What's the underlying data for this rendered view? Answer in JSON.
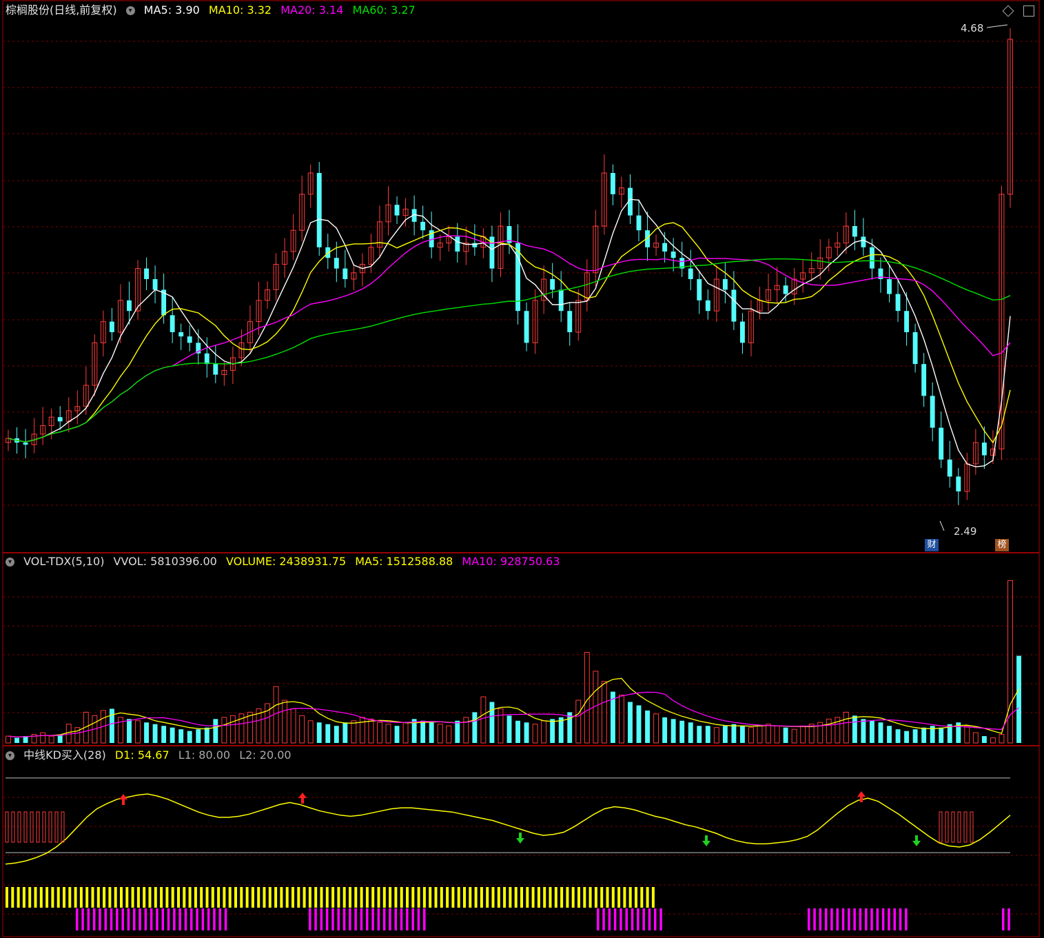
{
  "main_header": {
    "stock_name": "棕榈股份(日线,前复权)",
    "ma5_label": "MA5: 3.90",
    "ma10_label": "MA10: 3.32",
    "ma20_label": "MA20: 3.14",
    "ma60_label": "MA60: 3.27"
  },
  "volume_header": {
    "indicator_name": "VOL-TDX(5,10)",
    "vvol_label": "VVOL: 5810396.00",
    "volume_label": "VOLUME: 2438931.75",
    "ma5_label": "MA5: 1512588.88",
    "ma10_label": "MA10: 928750.63"
  },
  "kd_header": {
    "indicator_name": "中线KD买入(28)",
    "d1_label": "D1: 54.67",
    "l1_label": "L1: 80.00",
    "l2_label": "L2: 20.00"
  },
  "annotations": {
    "high_price": "4.68",
    "low_price": "2.49",
    "badge_finance": "财",
    "badge_rank": "榜"
  },
  "colors": {
    "up": "#ff3b3b",
    "down": "#54fcfc",
    "ma5": "#ffffff",
    "ma10": "#ffff00",
    "ma20": "#ff00ff",
    "ma60": "#00e000",
    "grid": "#7a0000",
    "kd_line": "#ffff00",
    "bar_yellow": "#ffff00",
    "bar_magenta": "#ff00ff"
  },
  "chart_data": [
    {
      "type": "candlestick",
      "title": "棕榈股份(日线,前复权)",
      "ylim": [
        2.3,
        4.8
      ],
      "high": 4.68,
      "low": 2.49,
      "closes": [
        2.8,
        2.78,
        2.77,
        2.82,
        2.86,
        2.9,
        2.88,
        2.93,
        2.95,
        3.05,
        3.25,
        3.35,
        3.3,
        3.45,
        3.4,
        3.6,
        3.55,
        3.5,
        3.38,
        3.3,
        3.28,
        3.25,
        3.2,
        3.15,
        3.1,
        3.12,
        3.18,
        3.25,
        3.35,
        3.45,
        3.5,
        3.62,
        3.68,
        3.78,
        3.95,
        4.05,
        3.7,
        3.65,
        3.6,
        3.55,
        3.58,
        3.62,
        3.7,
        3.82,
        3.9,
        3.85,
        3.88,
        3.82,
        3.78,
        3.7,
        3.72,
        3.75,
        3.68,
        3.72,
        3.7,
        3.75,
        3.6,
        3.8,
        3.72,
        3.4,
        3.25,
        3.45,
        3.55,
        3.5,
        3.4,
        3.3,
        3.45,
        3.58,
        3.8,
        4.05,
        3.95,
        3.98,
        3.85,
        3.78,
        3.7,
        3.72,
        3.68,
        3.65,
        3.6,
        3.55,
        3.45,
        3.4,
        3.55,
        3.5,
        3.35,
        3.25,
        3.4,
        3.45,
        3.5,
        3.52,
        3.48,
        3.55,
        3.58,
        3.6,
        3.65,
        3.7,
        3.72,
        3.8,
        3.75,
        3.7,
        3.6,
        3.55,
        3.48,
        3.4,
        3.3,
        3.15,
        3.0,
        2.85,
        2.7,
        2.62,
        2.55,
        2.68,
        2.78,
        2.72,
        2.75,
        3.95,
        4.68
      ],
      "ma_values": {
        "MA5": 3.9,
        "MA10": 3.32,
        "MA20": 3.14,
        "MA60": 3.27
      }
    },
    {
      "type": "bar",
      "title": "VOL-TDX(5,10)",
      "values": [
        0.4,
        0.3,
        0.4,
        0.5,
        0.6,
        0.4,
        0.5,
        1.1,
        0.9,
        1.8,
        1.6,
        1.9,
        2.0,
        1.5,
        1.4,
        1.3,
        1.2,
        1.1,
        1.0,
        0.9,
        0.8,
        0.7,
        0.8,
        0.9,
        1.4,
        1.5,
        1.6,
        1.7,
        1.8,
        2.0,
        2.3,
        3.3,
        2.5,
        2.0,
        1.6,
        1.3,
        1.2,
        1.1,
        1.0,
        1.2,
        1.3,
        1.5,
        1.4,
        1.2,
        1.1,
        1.0,
        1.2,
        1.4,
        1.3,
        1.2,
        1.1,
        1.0,
        1.3,
        1.5,
        1.8,
        2.7,
        2.4,
        2.0,
        1.6,
        1.3,
        1.2,
        1.1,
        1.3,
        1.4,
        1.5,
        1.8,
        2.5,
        5.3,
        4.2,
        3.6,
        3.0,
        2.8,
        2.4,
        2.2,
        1.9,
        1.7,
        1.5,
        1.4,
        1.3,
        1.2,
        1.0,
        1.0,
        0.9,
        1.0,
        1.1,
        1.0,
        0.9,
        1.0,
        1.1,
        1.0,
        0.9,
        0.8,
        1.0,
        1.1,
        1.2,
        1.4,
        1.5,
        1.8,
        1.6,
        1.4,
        1.3,
        1.2,
        1.0,
        0.8,
        0.7,
        0.8,
        0.9,
        1.0,
        0.9,
        1.1,
        1.2,
        1.0,
        0.6,
        0.4,
        0.3,
        0.5,
        9.5,
        5.1
      ],
      "ylim": [
        0,
        10
      ]
    },
    {
      "type": "line",
      "title": "中线KD买入(28)",
      "ylim": [
        0,
        100
      ],
      "thresholds": {
        "L1": 80,
        "L2": 20
      },
      "values": [
        8,
        9,
        11,
        14,
        18,
        24,
        32,
        42,
        52,
        60,
        65,
        69,
        71,
        73,
        74,
        72,
        69,
        65,
        61,
        57,
        54,
        52,
        52,
        53,
        55,
        58,
        61,
        64,
        66,
        64,
        61,
        58,
        56,
        54,
        53,
        54,
        56,
        58,
        60,
        61,
        61,
        60,
        59,
        58,
        57,
        55,
        53,
        51,
        49,
        46,
        43,
        40,
        37,
        35,
        36,
        38,
        43,
        49,
        55,
        60,
        62,
        61,
        59,
        56,
        53,
        51,
        48,
        45,
        43,
        40,
        37,
        33,
        30,
        28,
        27,
        27,
        28,
        29,
        31,
        34,
        40,
        48,
        56,
        63,
        68,
        70,
        67,
        61,
        55,
        48,
        41,
        34,
        28,
        25,
        24,
        26,
        31,
        38,
        46,
        54
      ],
      "current": 54.67
    }
  ]
}
